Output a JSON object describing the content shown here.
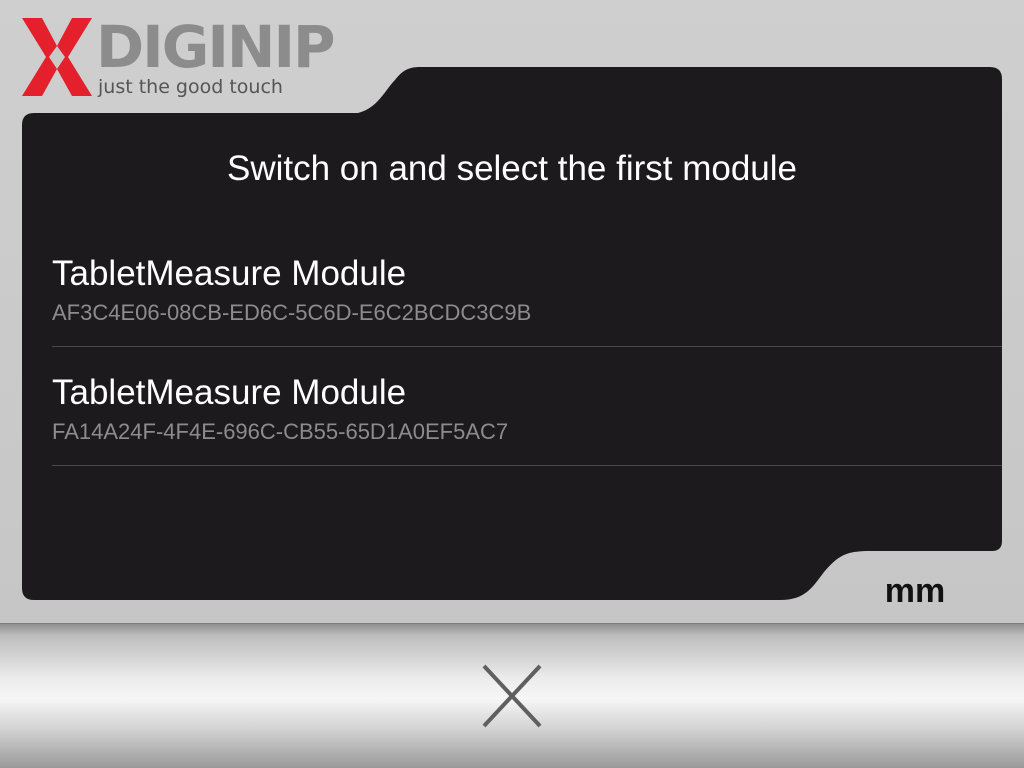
{
  "brand": {
    "name": "DIGINIP",
    "tagline": "just the good touch",
    "accent_color": "#e3202c",
    "wordmark_color": "#8c8c8c"
  },
  "panel": {
    "title": "Switch on and select the first module",
    "background": "#1c1a1d"
  },
  "devices": [
    {
      "name": "TabletMeasure Module",
      "id": "AF3C4E06-08CB-ED6C-5C6D-E6C2BCDC3C9B"
    },
    {
      "name": "TabletMeasure Module",
      "id": "FA14A24F-4F4E-696C-CB55-65D1A0EF5AC7"
    }
  ],
  "unit": {
    "label": "mm"
  },
  "toolbar": {
    "close_icon": "close-icon"
  }
}
